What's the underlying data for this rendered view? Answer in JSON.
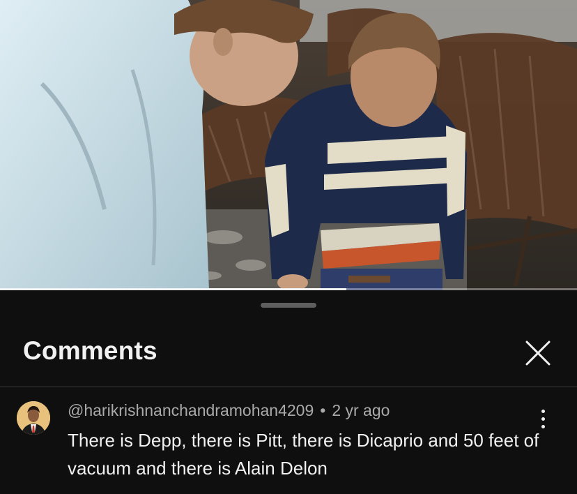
{
  "video": {
    "progress": 0.6
  },
  "comments_panel": {
    "title": "Comments",
    "close_icon": "close-icon",
    "items": [
      {
        "author": "@harikrishnanchandramohan4209",
        "separator": "•",
        "time": "2 yr ago",
        "text": "There is Depp, there is Pitt, there is Dicaprio and 50 feet of vacuum and there is Alain Delon",
        "more_icon": "more-vertical-icon"
      }
    ]
  },
  "colors": {
    "background": "#0f0f0f",
    "text_primary": "#f1f1f1",
    "text_secondary": "#aaaaaa",
    "progress": "#f1f1f1"
  }
}
